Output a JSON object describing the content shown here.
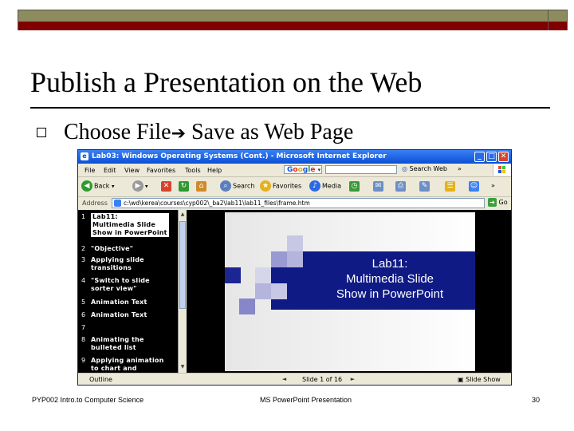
{
  "slide": {
    "title": "Publish a Presentation on the Web",
    "bullet": {
      "text": "Choose File",
      "arrow": "➔",
      "text_after": " Save as Web Page"
    }
  },
  "browser": {
    "title": "Lab03: Windows Operating Systems (Cont.) - Microsoft Internet Explorer",
    "window_buttons": {
      "minimize": "_",
      "maximize": "□",
      "close": "✕"
    },
    "menu": [
      "File",
      "Edit",
      "View",
      "Favorites",
      "Tools",
      "Help"
    ],
    "google": {
      "letters": [
        "G",
        "o",
        "o",
        "g",
        "l",
        "e"
      ],
      "dropdown": "▾",
      "search_web_label": "Search Web",
      "more": "»"
    },
    "toolbar": {
      "back": "Back",
      "search": "Search",
      "favorites": "Favorites",
      "media": "Media",
      "more": "»"
    },
    "address": {
      "label": "Address",
      "value": "c:\\wd\\kerea\\courses\\cyp002\\_ba2\\lab11\\lab11_files\\frame.htm",
      "go": "Go"
    },
    "outline": [
      {
        "num": "1",
        "text": "Lab11:\nMultimedia Slide\nShow in PowerPoint",
        "selected": true
      },
      {
        "num": "2",
        "text": "\"Objective\""
      },
      {
        "num": "3",
        "text": "Applying slide\ntransitions"
      },
      {
        "num": "4",
        "text": "\"Switch to slide\nsorter view\""
      },
      {
        "num": "5",
        "text": "Animation Text"
      },
      {
        "num": "6",
        "text": "Animation Text"
      },
      {
        "num": "7",
        "text": ""
      },
      {
        "num": "8",
        "text": "Animating the\nbulleted list"
      },
      {
        "num": "9",
        "text": "Applying animation\nto chart and"
      }
    ],
    "slide_text": "Lab11:\nMultimedia Slide\nShow in PowerPoint",
    "status": {
      "outline": "Outline",
      "slide_counter": "Slide 1 of 16",
      "slide_show": "Slide Show"
    }
  },
  "footer": {
    "left": "PYP002 Intro.to Computer Science",
    "center": "MS PowerPoint Presentation",
    "page": "30"
  },
  "colors": {
    "olive_bar": "#8c8c5e",
    "maroon_bar": "#800000",
    "slide_band": "#0f1a85",
    "titlebar_blue": "#0a4fd6"
  }
}
